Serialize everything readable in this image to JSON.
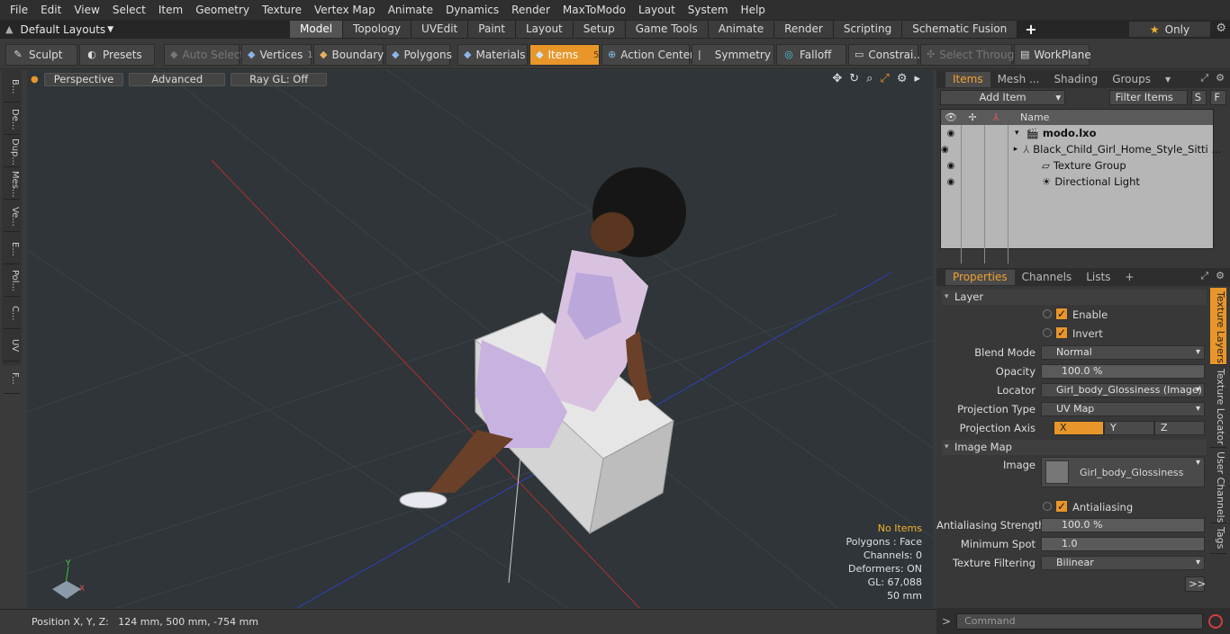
{
  "menubar": [
    "File",
    "Edit",
    "View",
    "Select",
    "Item",
    "Geometry",
    "Texture",
    "Vertex Map",
    "Animate",
    "Dynamics",
    "Render",
    "MaxToModo",
    "Layout",
    "System",
    "Help"
  ],
  "modebar": {
    "layouts": "Default Layouts",
    "tabs": [
      "Model",
      "Topology",
      "UVEdit",
      "Paint",
      "Layout",
      "Setup",
      "Game Tools",
      "Animate",
      "Render",
      "Scripting",
      "Schematic Fusion"
    ],
    "active_tab": "Model",
    "only": "Only"
  },
  "toolbar": {
    "sculpt": "Sculpt",
    "presets": "Presets",
    "auto_select": "Auto Select",
    "vertices": "Vertices",
    "vertices_count": "1",
    "boundary": "Boundary",
    "polygons": "Polygons",
    "materials": "Materials",
    "items": "Items",
    "items_count": "5",
    "action_center": "Action Center",
    "symmetry": "Symmetry",
    "falloff": "Falloff",
    "constraints": "Constrai...",
    "select_through": "Select Through",
    "workplane": "WorkPlane"
  },
  "left_tabs": [
    "B...",
    "De...",
    "Dup...",
    "Mes...",
    "Ve...",
    "E...",
    "Pol...",
    "C...",
    "UV",
    "F..."
  ],
  "viewport": {
    "perspective": "Perspective",
    "advanced": "Advanced",
    "raygl": "Ray GL: Off",
    "info": {
      "no_items": "No Items",
      "polygons": "Polygons : Face",
      "channels": "Channels: 0",
      "deformers": "Deformers: ON",
      "gl": "GL: 67,088",
      "size": "50 mm"
    },
    "axis_x": "X",
    "axis_y": "Y"
  },
  "status": "Position X, Y, Z:   124 mm, 500 mm, -754 mm",
  "items_panel": {
    "tabs": [
      "Items",
      "Mesh ...",
      "Shading",
      "Groups"
    ],
    "active_tab": "Items",
    "add_item": "Add Item",
    "filter": "Filter Items",
    "s_btn": "S",
    "f_btn": "F",
    "name_col": "Name",
    "rows": [
      {
        "label": "modo.lxo"
      },
      {
        "label": "Black_Child_Girl_Home_Style_Sitti ..."
      },
      {
        "label": "Texture Group"
      },
      {
        "label": "Directional Light"
      }
    ]
  },
  "properties": {
    "tabs": [
      "Properties",
      "Channels",
      "Lists"
    ],
    "active_tab": "Properties",
    "layer_section": "Layer",
    "enable": "Enable",
    "invert": "Invert",
    "blend_mode_label": "Blend Mode",
    "blend_mode": "Normal",
    "opacity_label": "Opacity",
    "opacity": "100.0 %",
    "locator_label": "Locator",
    "locator": "Girl_body_Glossiness (Image) ( ...",
    "proj_type_label": "Projection Type",
    "proj_type": "UV Map",
    "proj_axis_label": "Projection Axis",
    "axes": [
      "X",
      "Y",
      "Z"
    ],
    "image_map_section": "Image Map",
    "image_label": "Image",
    "image": "Girl_body_Glossiness",
    "antialiasing": "Antialiasing",
    "aa_strength_label": "Antialiasing Strength",
    "aa_strength": "100.0 %",
    "min_spot_label": "Minimum Spot",
    "min_spot": "1.0",
    "tex_filter_label": "Texture Filtering",
    "tex_filter": "Bilinear",
    "more": ">>",
    "side_tabs": [
      "Texture Layers",
      "Texture Locator",
      "User Channels",
      "Tags"
    ]
  },
  "command_placeholder": "Command",
  "colors": {
    "accent": "#e8962a",
    "viewport_bg": "#2f3538"
  }
}
